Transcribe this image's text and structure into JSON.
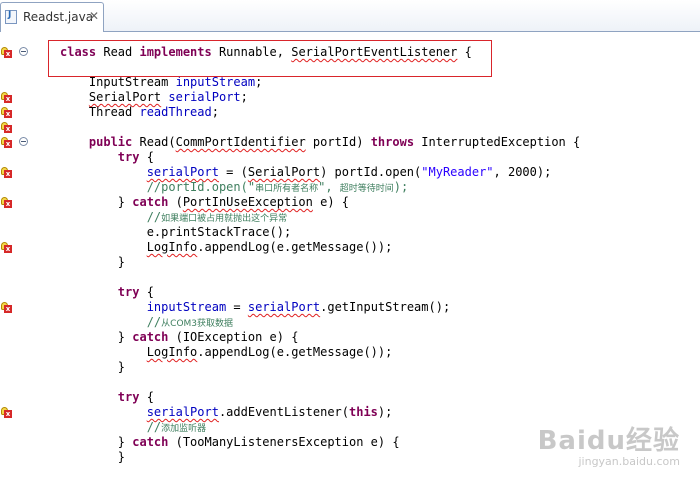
{
  "tab": {
    "label": "Readst.java",
    "close": "✕"
  },
  "colors": {
    "keyword": "#7f0055",
    "field": "#0000c0",
    "string": "#2a00ff",
    "comment": "#3f7f5f",
    "highlight_box": "#d9252b"
  },
  "code": {
    "l1": {
      "kw1": "class",
      "t1": " Read ",
      "kw2": "implements",
      "t2": " Runnable, ",
      "e1": "SerialPortEventListener",
      "t3": " {"
    },
    "l3": {
      "t1": "    InputStream ",
      "f1": "inputStream",
      "t2": ";"
    },
    "l4": {
      "i": "    ",
      "e1": "SerialPort",
      "t1": " ",
      "f1": "serialPort",
      "t2": ";"
    },
    "l5": {
      "t1": "    Thread ",
      "f1": "readThread",
      "t2": ";"
    },
    "l7": {
      "i": "    ",
      "kw1": "public",
      "t1": " Read(",
      "e1": "CommPortIdentifier",
      "t2": " portId) ",
      "kw2": "throws",
      "t3": " InterruptedException {"
    },
    "l8": {
      "i": "        ",
      "kw1": "try",
      "t1": " {"
    },
    "l9": {
      "i": "            ",
      "e1": "serialPort",
      "t1": " = (",
      "e2": "SerialPort",
      "t2": ") portId.open(",
      "s1": "\"MyReader\"",
      "t3": ", 2000);"
    },
    "l10": {
      "i": "            ",
      "c1": "//portId.open(\"",
      "c2": "串口所有者名称",
      "c3": "\", ",
      "c4": "超时等待时间",
      "c5": ");"
    },
    "l11": {
      "i": "        } ",
      "kw1": "catch",
      "t1": " (",
      "e1": "PortInUseException",
      "t2": " e) {"
    },
    "l12": {
      "i": "            ",
      "c1": "//",
      "c2": "如果端口被占用就抛出这个异常"
    },
    "l13": {
      "t1": "            e.printStackTrace();"
    },
    "l14": {
      "i": "            ",
      "e1": "LogInfo",
      "t1": ".appendLog(e.getMessage());"
    },
    "l15": {
      "t1": "        }"
    },
    "l17": {
      "i": "        ",
      "kw1": "try",
      "t1": " {"
    },
    "l18": {
      "i": "            ",
      "f1": "inputStream",
      "t1": " = ",
      "e1": "serialPort",
      "t2": ".getInputStream();"
    },
    "l19": {
      "i": "            ",
      "c1": "//",
      "c2": "从COM3获取数据"
    },
    "l20": {
      "i": "        } ",
      "kw1": "catch",
      "t1": " (IOException e) {"
    },
    "l21": {
      "i": "            ",
      "e1": "LogInfo",
      "t1": ".appendLog(e.getMessage());"
    },
    "l22": {
      "t1": "        }"
    },
    "l24": {
      "i": "        ",
      "kw1": "try",
      "t1": " {"
    },
    "l25": {
      "i": "            ",
      "e1": "serialPort",
      "t1": ".addEventListener(",
      "kw1": "this",
      "t2": ");"
    },
    "l26": {
      "i": "            ",
      "c1": "//",
      "c2": "添加监听器"
    },
    "l27": {
      "i": "        } ",
      "kw1": "catch",
      "t1": " (TooManyListenersException e) {"
    },
    "l28": {
      "t1": "        }"
    }
  },
  "watermark": {
    "brand": "Baidu经验",
    "site": "jingyan.baidu.com"
  }
}
